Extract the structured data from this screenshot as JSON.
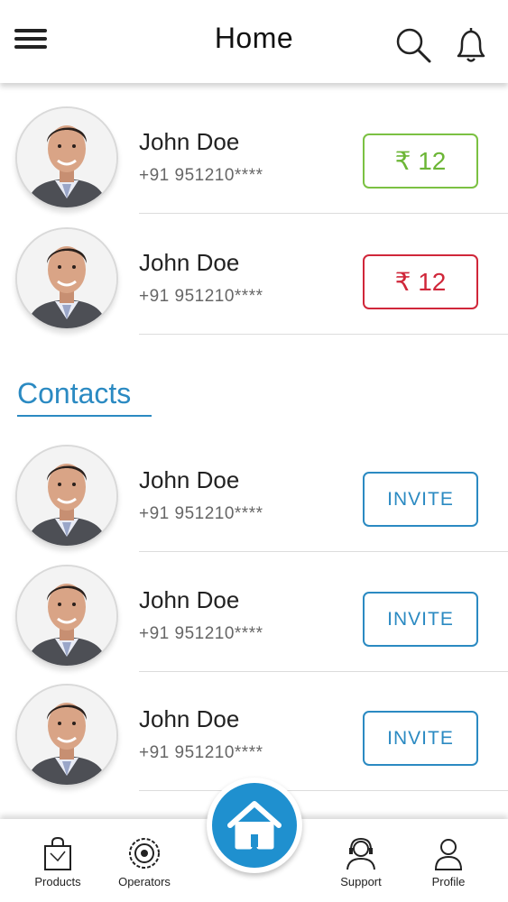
{
  "header": {
    "title": "Home",
    "menu_icon": "hamburger-menu-icon",
    "search_icon": "search-icon",
    "notification_icon": "bell-icon"
  },
  "recent": [
    {
      "name": "John Doe",
      "phone": "+91 951210****",
      "amount": "₹ 12",
      "status_color": "#7bc142"
    },
    {
      "name": "John Doe",
      "phone": "+91 951210****",
      "amount": "₹ 12",
      "status_color": "#d0273a"
    }
  ],
  "contacts_section": {
    "title": "Contacts",
    "items": [
      {
        "name": "John Doe",
        "phone": "+91 951210****",
        "action": "INVITE"
      },
      {
        "name": "John Doe",
        "phone": "+91 951210****",
        "action": "INVITE"
      },
      {
        "name": "John Doe",
        "phone": "+91 951210****",
        "action": "INVITE"
      }
    ]
  },
  "bottom_nav": {
    "items": [
      {
        "label": "Products",
        "icon": "shopping-bag-icon"
      },
      {
        "label": "Operators",
        "icon": "operators-gear-icon"
      },
      {
        "label": "Support",
        "icon": "headset-support-icon"
      },
      {
        "label": "Profile",
        "icon": "profile-user-icon"
      }
    ],
    "home_icon": "home-icon"
  },
  "colors": {
    "accent": "#2b8ac2",
    "home_fab": "#1f90cf",
    "positive": "#7bc142",
    "negative": "#d0273a"
  }
}
